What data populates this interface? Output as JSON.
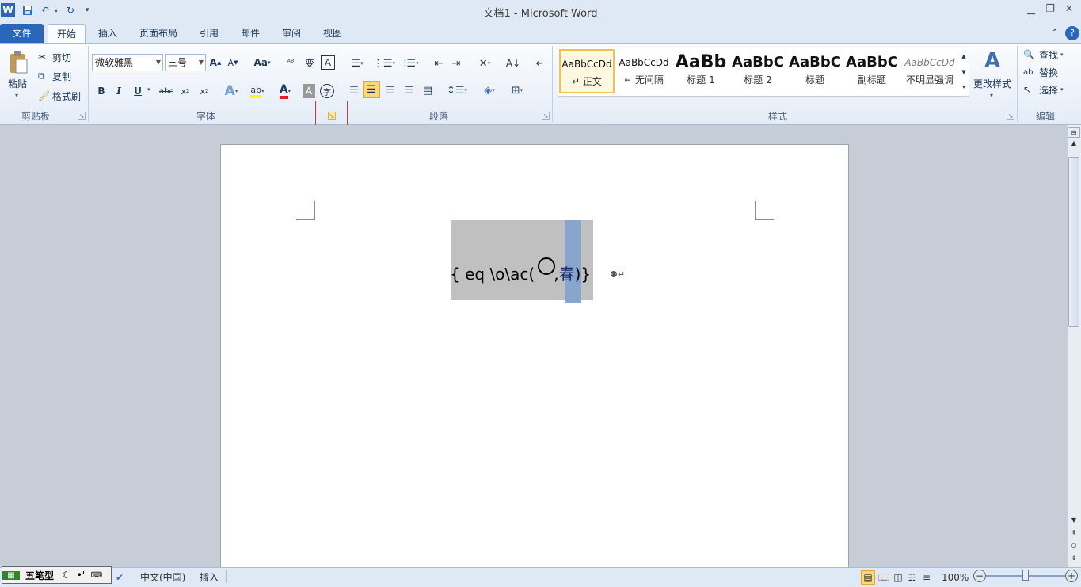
{
  "window": {
    "title": "文档1 - Microsoft Word"
  },
  "qat": {
    "save_icon": "save-icon",
    "undo_icon": "undo-icon",
    "redo_icon": "redo-icon"
  },
  "tabs": [
    {
      "label": "文件"
    },
    {
      "label": "开始"
    },
    {
      "label": "插入"
    },
    {
      "label": "页面布局"
    },
    {
      "label": "引用"
    },
    {
      "label": "邮件"
    },
    {
      "label": "审阅"
    },
    {
      "label": "视图"
    }
  ],
  "clipboard": {
    "paste": "粘贴",
    "cut": "剪切",
    "copy": "复制",
    "format_painter": "格式刷",
    "group": "剪贴板"
  },
  "font": {
    "name": "微软雅黑",
    "size": "三号",
    "group": "字体",
    "case": "Aa"
  },
  "paragraph": {
    "group": "段落"
  },
  "styles": {
    "group": "样式",
    "items": [
      {
        "sample": "AaBbCcDd",
        "name": "↵ 正文"
      },
      {
        "sample": "AaBbCcDd",
        "name": "↵ 无间隔"
      },
      {
        "sample": "AaBb",
        "name": "标题 1"
      },
      {
        "sample": "AaBbC",
        "name": "标题 2"
      },
      {
        "sample": "AaBbC",
        "name": "标题"
      },
      {
        "sample": "AaBbC",
        "name": "副标题"
      },
      {
        "sample": "AaBbCcDd",
        "name": "不明显强调"
      }
    ],
    "change": "更改样式"
  },
  "editing": {
    "find": "查找",
    "replace": "替换",
    "select": "选择",
    "group": "编辑"
  },
  "document": {
    "field_open": "{  eq \\o\\ac(",
    "field_comma": ",",
    "field_char": "春",
    "field_close": ")}"
  },
  "status": {
    "ime_name": "五笔型",
    "language": "中文(中国)",
    "mode": "插入",
    "zoom": "100%"
  },
  "colors": {
    "file_tab": "#2a66b9",
    "selection": "#8aa5cc",
    "field_shading": "#c0c0c0",
    "highlight_box": "#e03030"
  }
}
